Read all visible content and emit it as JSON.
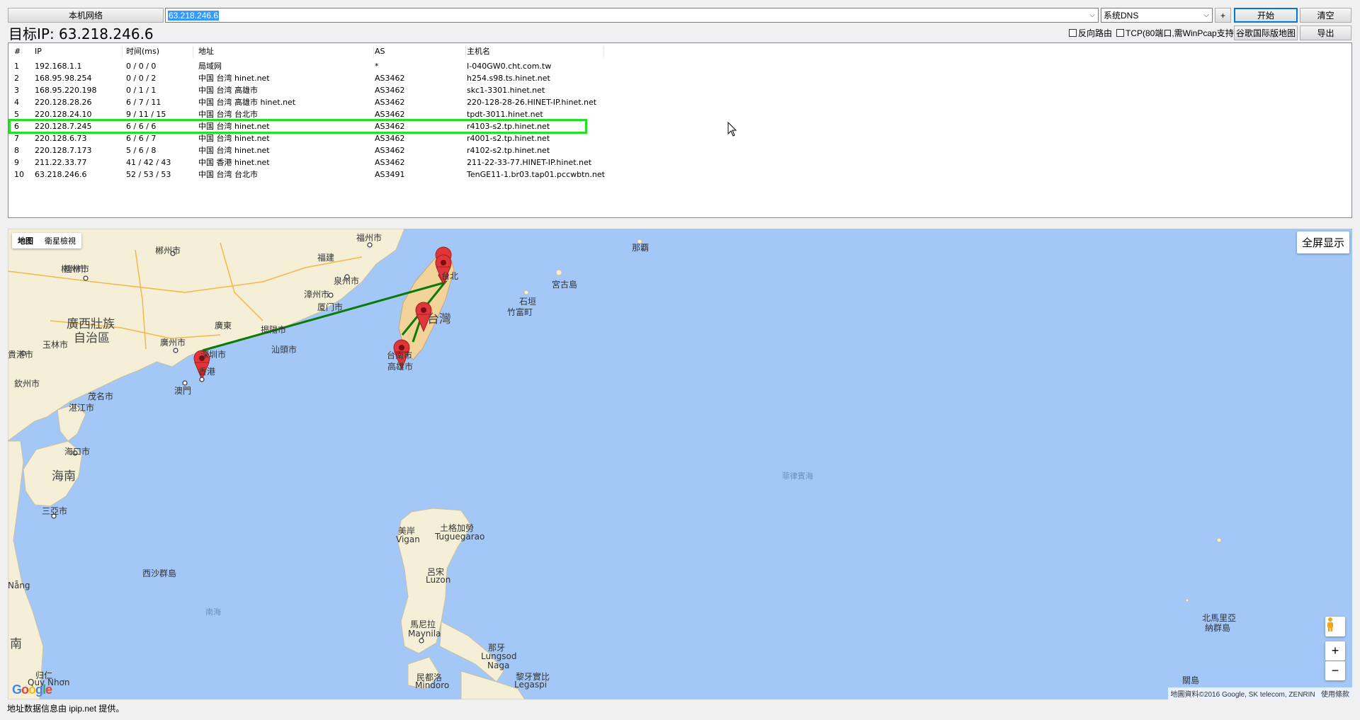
{
  "toolbar": {
    "network_button": "本机网络",
    "target_value": "63.218.246.6",
    "dns_value": "系统DNS",
    "add_button": "+",
    "start_button": "开始",
    "clear_button": "清空",
    "reverse_route_label": "反向路由",
    "tcp_label": "TCP(80端口,需WinPcap支持)",
    "google_intl_button": "谷歌国际版地图",
    "export_button": "导出"
  },
  "target_title": "目标IP: 63.218.246.6",
  "table": {
    "headers": [
      "#",
      "IP",
      "时间(ms)",
      "地址",
      "AS",
      "主机名"
    ],
    "rows": [
      {
        "n": "1",
        "ip": "192.168.1.1",
        "time": "0 / 0 / 0",
        "addr": "局域网",
        "as": "*",
        "host": "I-040GW0.cht.com.tw"
      },
      {
        "n": "2",
        "ip": "168.95.98.254",
        "time": "0 / 0 / 2",
        "addr": "中国 台湾 hinet.net",
        "as": "AS3462",
        "host": "h254.s98.ts.hinet.net"
      },
      {
        "n": "3",
        "ip": "168.95.220.198",
        "time": "0 / 1 / 1",
        "addr": "中国 台湾 高雄市",
        "as": "AS3462",
        "host": "skc1-3301.hinet.net"
      },
      {
        "n": "4",
        "ip": "220.128.28.26",
        "time": "6 / 7 / 11",
        "addr": "中国 台湾 高雄市 hinet.net",
        "as": "AS3462",
        "host": "220-128-28-26.HINET-IP.hinet.net"
      },
      {
        "n": "5",
        "ip": "220.128.24.10",
        "time": "9 / 11 / 15",
        "addr": "中国 台湾 台北市",
        "as": "AS3462",
        "host": "tpdt-3011.hinet.net"
      },
      {
        "n": "6",
        "ip": "220.128.7.245",
        "time": "6 / 6 / 6",
        "addr": "中国 台湾 hinet.net",
        "as": "AS3462",
        "host": "r4103-s2.tp.hinet.net"
      },
      {
        "n": "7",
        "ip": "220.128.6.73",
        "time": "6 / 6 / 7",
        "addr": "中国 台湾 hinet.net",
        "as": "AS3462",
        "host": "r4001-s2.tp.hinet.net"
      },
      {
        "n": "8",
        "ip": "220.128.7.173",
        "time": "5 / 6 / 8",
        "addr": "中国 台湾 hinet.net",
        "as": "AS3462",
        "host": "r4102-s2.tp.hinet.net"
      },
      {
        "n": "9",
        "ip": "211.22.33.77",
        "time": "41 / 42 / 43",
        "addr": "中国 香港 hinet.net",
        "as": "AS3462",
        "host": "211-22-33-77.HINET-IP.hinet.net"
      },
      {
        "n": "10",
        "ip": "63.218.246.6",
        "time": "52 / 53 / 53",
        "addr": "中国 台湾 台北市",
        "as": "AS3491",
        "host": "TenGE11-1.br03.tap01.pccwbtn.net"
      }
    ],
    "highlight_color": "#22e022"
  },
  "map": {
    "map_type_buttons": [
      "地图",
      "衛星檢視"
    ],
    "fullscreen_label": "全屏显示",
    "zoom_in": "+",
    "zoom_out": "−",
    "attribution": "地圖資料©2016 Google, SK telecom, ZENRIN",
    "terms": "使用條款",
    "logo_text": "Google",
    "route_color": "#0a7a0a",
    "marker_color": "#e0363a",
    "labels": {
      "fuzhou": "福州市",
      "chenzhou": "郴州市",
      "fujian": "福建",
      "quanzhou": "泉州市",
      "guilin": "桂林市",
      "zhangzhou": "漳州市",
      "xiamen": "厦门市",
      "guangxi": "廣西壯族",
      "guangxi2": "自治區",
      "guangdong": "廣東",
      "jieyang": "揭陽市",
      "shantou": "汕頭市",
      "guangzhou": "廣州市",
      "shenzhen": "深圳市",
      "guigang": "貴港市",
      "yulin": "玉林市",
      "hongkong": "香港",
      "macau": "澳門",
      "qinzhou": "欽州市",
      "maoming": "茂名市",
      "zhanjiang": "湛江市",
      "haikou": "海口市",
      "hainan": "海南",
      "sanya": "三亞市",
      "taipei": "台北",
      "taiwan": "台灣",
      "tainan": "台南市",
      "kaohsiung": "高雄市",
      "naha": "那覇",
      "miyakojima": "宮古島",
      "ishigaki": "石垣",
      "taketomi": "竹富町",
      "philippine_sea": "菲律賓海",
      "xisha": "西沙群島",
      "south_sea": "南海",
      "vigan": "美岸",
      "vigan2": "Vigan",
      "tuguegarao": "土格加勞",
      "tuguegarao2": "Tuguegarao",
      "luzon": "呂宋",
      "luzon2": "Luzon",
      "manila": "馬尼拉",
      "manila2": "Maynila",
      "lungsod": "那牙",
      "lungsod2": "Lungsod",
      "naga": "Naga",
      "legaspi": "黎牙實比",
      "legaspi2": "Legaspi",
      "mindoro": "民都洛",
      "mindoro2": "Mindoro",
      "nanan": "南",
      "danang": "Nẵng",
      "quynhon": "Quy Nhơn",
      "quynhon2": "归仁",
      "nmarianas": "北馬里亞",
      "nmarianas2": "納群島",
      "guam": "關島",
      "liuzhou": "柳州市"
    }
  },
  "footer": "地址数据信息由 ipip.net 提供。"
}
